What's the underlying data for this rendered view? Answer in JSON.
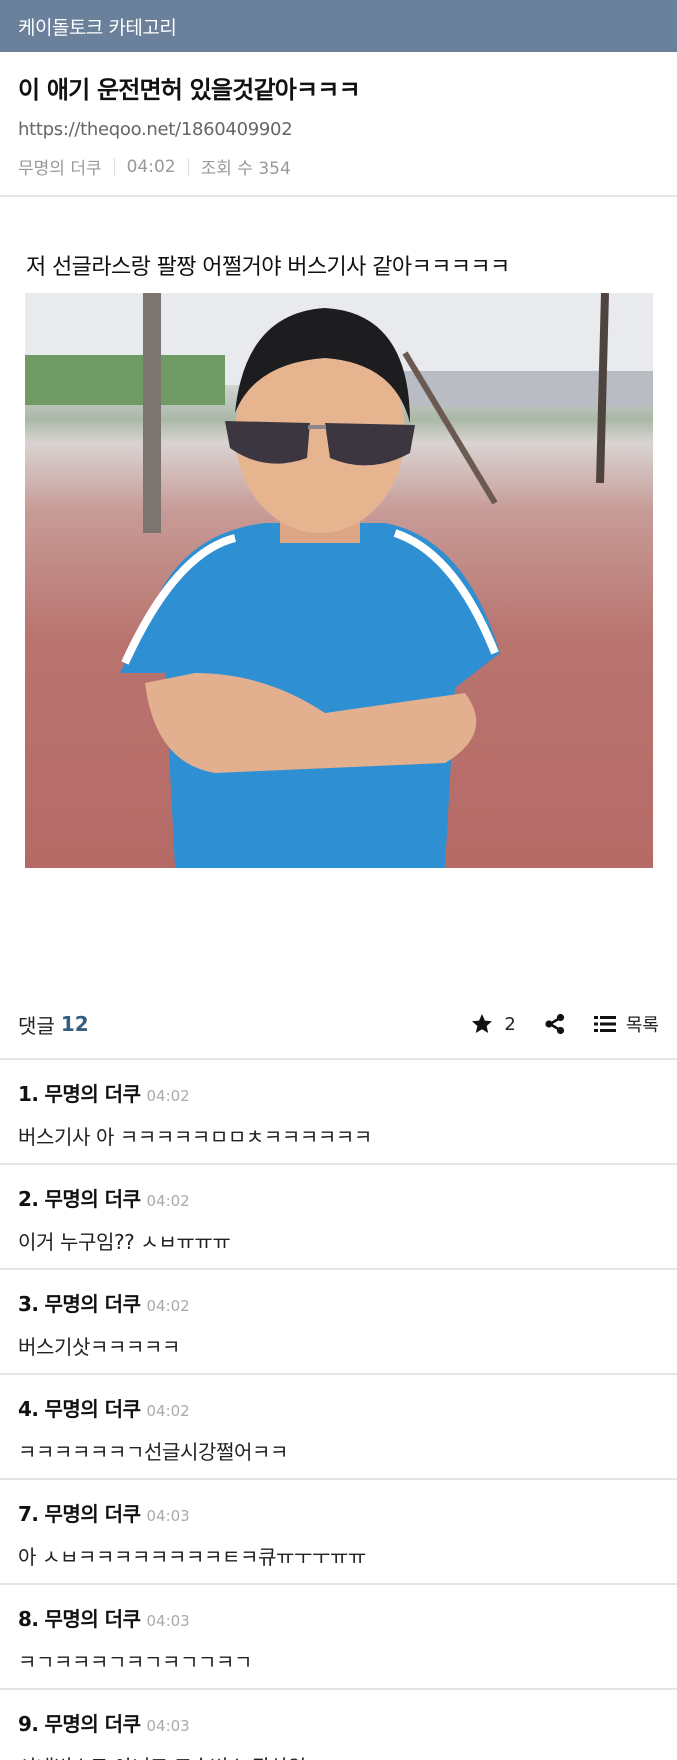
{
  "topbar": {
    "category": "케이돌토크 카테고리"
  },
  "post": {
    "title": "이 애기 운전면허 있을것같아ㅋㅋㅋ",
    "url": "https://theqoo.net/1860409902",
    "author": "무명의 더쿠",
    "time": "04:02",
    "views_label": "조회 수 354",
    "body_text": "저 선글라스랑 팔짱 어쩔거야 버스기사 같아ㅋㅋㅋㅋㅋ"
  },
  "comments_bar": {
    "label": "댓글",
    "count": "12",
    "star_count": "2",
    "list_label": "목록"
  },
  "comments": [
    {
      "num": "1.",
      "author": "무명의 더쿠",
      "time": "04:02",
      "text": "버스기사 아 ㅋㅋㅋㅋㅋㅁㅁㅊㅋㅋㅋㅋㅋㅋ"
    },
    {
      "num": "2.",
      "author": "무명의 더쿠",
      "time": "04:02",
      "text": "이거 누구임?? ㅅㅂㅠㅠㅠ"
    },
    {
      "num": "3.",
      "author": "무명의 더쿠",
      "time": "04:02",
      "text": "버스기삿ㅋㅋㅋㅋㅋ"
    },
    {
      "num": "4.",
      "author": "무명의 더쿠",
      "time": "04:02",
      "text": "ㅋㅋㅋㅋㅋㅋㄱ선글시강쩔어ㅋㅋ"
    },
    {
      "num": "7.",
      "author": "무명의 더쿠",
      "time": "04:03",
      "text": "아 ㅅㅂㅋㅋㅋㅋㅋㅋㅋㅋㅌㅋ큐ㅠㅜㅜㅠㅠ"
    },
    {
      "num": "8.",
      "author": "무명의 더쿠",
      "time": "04:03",
      "text": "ㅋㄱㅋㅋㅋㄱㅋㄱㅋㄱㄱㅋㄱ"
    },
    {
      "num": "9.",
      "author": "무명의 더쿠",
      "time": "04:03",
      "text": "시내버스도 아니고 고속버스 관상임"
    }
  ],
  "icons": {
    "star": "star-icon",
    "share": "share-icon",
    "list": "list-icon"
  },
  "colors": {
    "topbar": "#6b809b",
    "comment_count": "#355d7e"
  }
}
